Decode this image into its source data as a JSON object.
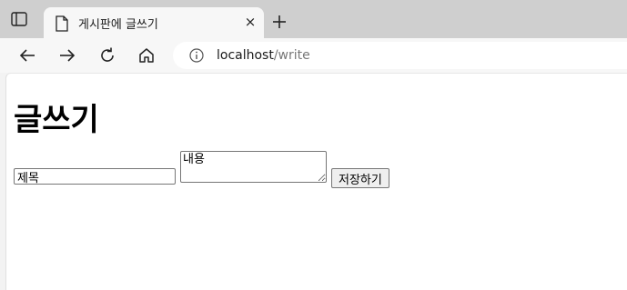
{
  "browser": {
    "tab_title": "게시판에 글쓰기",
    "tab_close": "×",
    "url_host": "localhost",
    "url_path": "/write",
    "icons": [
      "tab-actions-icon",
      "page-icon",
      "new-tab-icon",
      "back-icon",
      "forward-icon",
      "reload-icon",
      "home-icon",
      "info-icon"
    ]
  },
  "page": {
    "heading": "글쓰기",
    "title_input_value": "제목",
    "content_textarea_value": "내용",
    "save_label": "저장하기"
  }
}
